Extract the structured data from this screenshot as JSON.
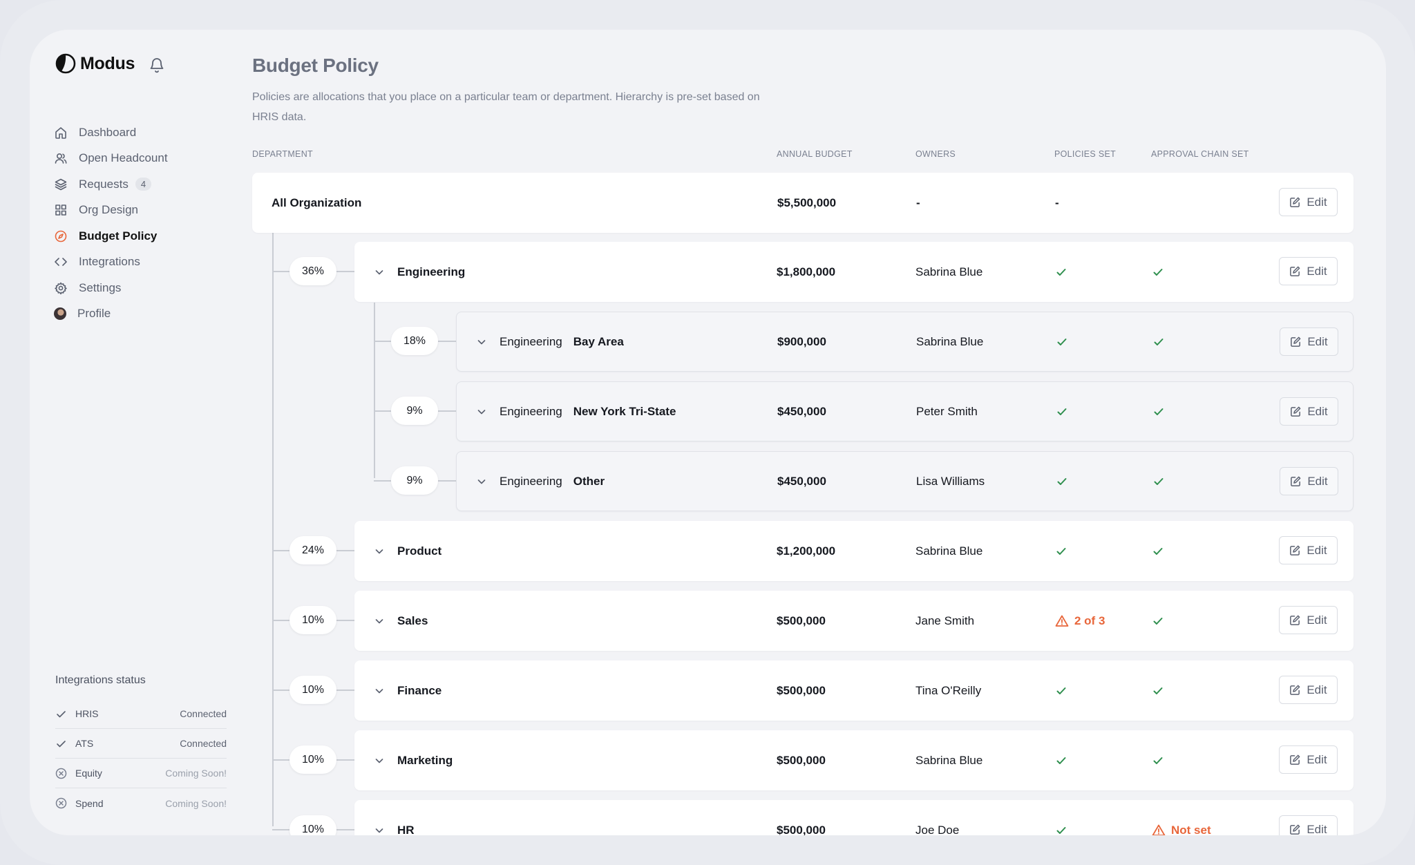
{
  "app": {
    "brand": "Modus"
  },
  "sidebar": {
    "items": [
      {
        "label": "Dashboard",
        "icon": "home-icon"
      },
      {
        "label": "Open Headcount",
        "icon": "users-icon"
      },
      {
        "label": "Requests",
        "icon": "layers-icon",
        "badge": "4"
      },
      {
        "label": "Org Design",
        "icon": "grid-icon"
      },
      {
        "label": "Budget Policy",
        "icon": "compass-icon",
        "active": true
      },
      {
        "label": "Integrations",
        "icon": "code-icon"
      },
      {
        "label": "Settings",
        "icon": "gear-icon"
      },
      {
        "label": "Profile",
        "icon": "avatar"
      }
    ],
    "integrations_title": "Integrations status",
    "integrations": [
      {
        "name": "HRIS",
        "status": "Connected",
        "icon": "check-icon"
      },
      {
        "name": "ATS",
        "status": "Connected",
        "icon": "check-icon"
      },
      {
        "name": "Equity",
        "status": "Coming Soon!",
        "icon": "x-circle-icon"
      },
      {
        "name": "Spend",
        "status": "Coming Soon!",
        "icon": "x-circle-icon"
      }
    ]
  },
  "page": {
    "title": "Budget Policy",
    "description": "Policies are allocations that you place on a particular team or department. Hierarchy is pre-set based on HRIS data."
  },
  "table": {
    "headers": {
      "department": "DEPARTMENT",
      "annual_budget": "ANNUAL BUDGET",
      "owners": "OWNERS",
      "policies_set": "POLICIES SET",
      "approval_chain_set": "APPROVAL CHAIN SET"
    },
    "edit_label": "Edit",
    "root": {
      "name": "All Organization",
      "budget": "$5,500,000",
      "owners": "-",
      "policies": "-"
    },
    "rows": [
      {
        "pct": "36%",
        "name": "Engineering",
        "budget": "$1,800,000",
        "owner": "Sabrina Blue",
        "policies": "check",
        "approval": "check"
      },
      {
        "pct": "18%",
        "parent": "Engineering",
        "name": "Bay Area",
        "budget": "$900,000",
        "owner": "Sabrina Blue",
        "policies": "check",
        "approval": "check"
      },
      {
        "pct": "9%",
        "parent": "Engineering",
        "name": "New York Tri-State",
        "budget": "$450,000",
        "owner": "Peter Smith",
        "policies": "check",
        "approval": "check"
      },
      {
        "pct": "9%",
        "parent": "Engineering",
        "name": "Other",
        "budget": "$450,000",
        "owner": "Lisa Williams",
        "policies": "check",
        "approval": "check"
      },
      {
        "pct": "24%",
        "name": "Product",
        "budget": "$1,200,000",
        "owner": "Sabrina Blue",
        "policies": "check",
        "approval": "check"
      },
      {
        "pct": "10%",
        "name": "Sales",
        "budget": "$500,000",
        "owner": "Jane Smith",
        "policies": "2 of 3",
        "approval": "check"
      },
      {
        "pct": "10%",
        "name": "Finance",
        "budget": "$500,000",
        "owner": "Tina O'Reilly",
        "policies": "check",
        "approval": "check"
      },
      {
        "pct": "10%",
        "name": "Marketing",
        "budget": "$500,000",
        "owner": "Sabrina Blue",
        "policies": "check",
        "approval": "check"
      },
      {
        "pct": "10%",
        "name": "HR",
        "budget": "$500,000",
        "owner": "Joe Doe",
        "policies": "check",
        "approval": "Not set"
      }
    ]
  },
  "colors": {
    "accent": "#e8663a",
    "success": "#2f8f4e"
  }
}
